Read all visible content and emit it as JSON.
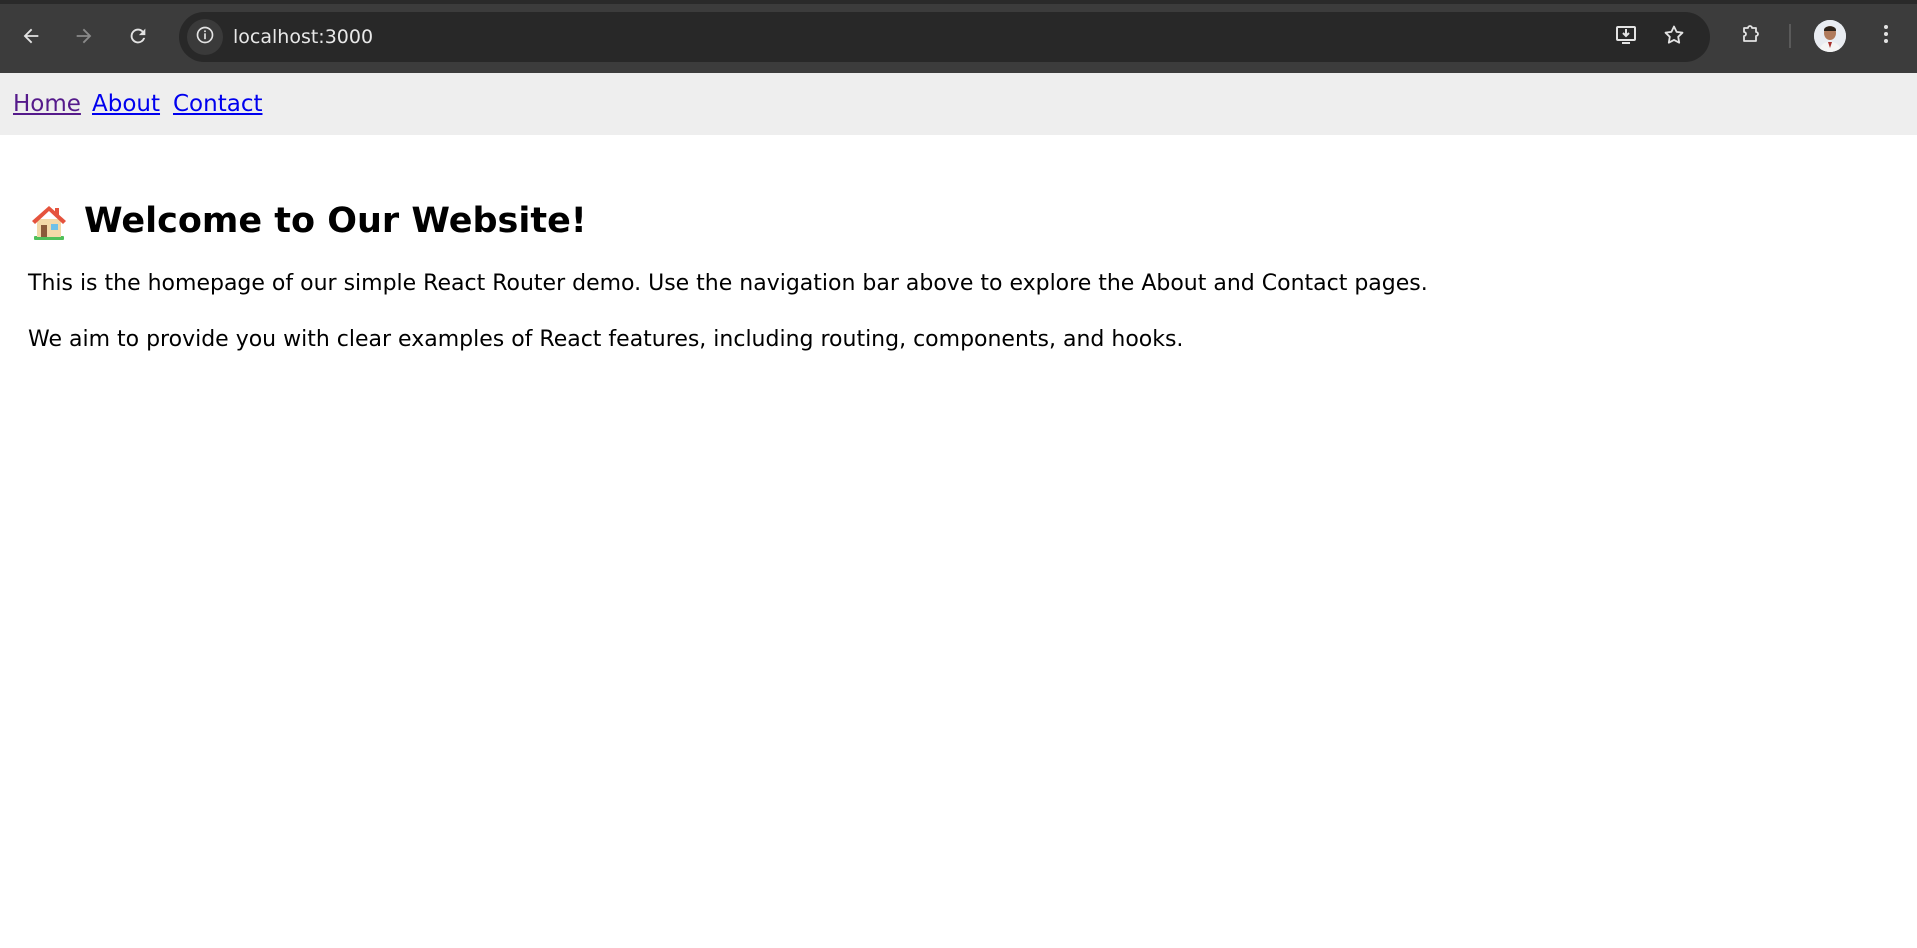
{
  "browser": {
    "url": "localhost:3000",
    "icons": {
      "back": "back-arrow-icon",
      "forward": "forward-arrow-icon",
      "reload": "reload-icon",
      "site_info": "info-icon",
      "install": "install-app-icon",
      "bookmark": "star-icon",
      "extensions": "puzzle-icon",
      "profile": "avatar",
      "menu": "kebab-menu-icon"
    },
    "colors": {
      "chrome_bg": "#3c3c3c",
      "omnibox_bg": "#282828",
      "url_text": "#e8e8e8"
    }
  },
  "nav": {
    "links": [
      {
        "label": "Home"
      },
      {
        "label": "About"
      },
      {
        "label": "Contact"
      }
    ],
    "colors": {
      "bar_bg": "#eeeeee",
      "visited_link": "#551a8b",
      "link": "#0000ee"
    }
  },
  "main": {
    "heading_icon": "house-icon",
    "heading": "Welcome to Our Website!",
    "paragraphs": [
      "This is the homepage of our simple React Router demo. Use the navigation bar above to explore the About and Contact pages.",
      "We aim to provide you with clear examples of React features, including routing, components, and hooks."
    ]
  }
}
